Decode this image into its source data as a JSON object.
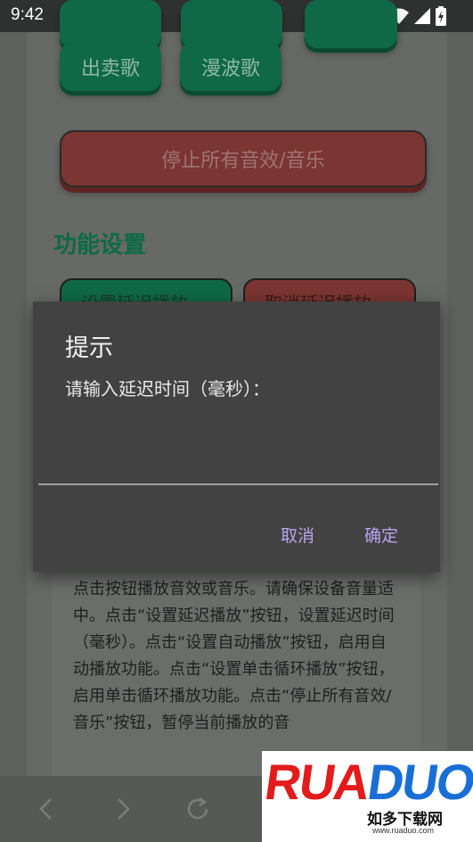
{
  "status_bar": {
    "time": "9:42",
    "icons": [
      "wifi-icon",
      "signal-icon",
      "battery-charging-icon"
    ]
  },
  "buttons": {
    "sell_song": "出卖歌",
    "wave_song": "漫波歌",
    "stop_all": "停止所有音效/音乐",
    "set_delay": "设置延迟播放",
    "cancel_delay": "取消延迟播放"
  },
  "section": {
    "function_settings": "功能设置"
  },
  "instructions": {
    "text": "点击按钮播放音效或音乐。请确保设备音量适中。点击“设置延迟播放”按钮，设置延迟时间（毫秒）。点击“设置自动播放”按钮，启用自动播放功能。点击“设置单击循环播放”按钮，启用单击循环播放功能。点击“停止所有音效/音乐”按钮，暂停当前播放的音"
  },
  "dialog": {
    "title": "提示",
    "message": "请输入延迟时间（毫秒）：",
    "input_value": "",
    "cancel": "取消",
    "confirm": "确定"
  },
  "watermark": {
    "brand": "RUADUO",
    "subtitle": "如多下载网",
    "url": "www.ruaduo.com"
  },
  "colors": {
    "green": "#0f6848",
    "red": "#7b3532",
    "dialog_bg": "#424242",
    "dialog_button": "#b7a4f0"
  }
}
